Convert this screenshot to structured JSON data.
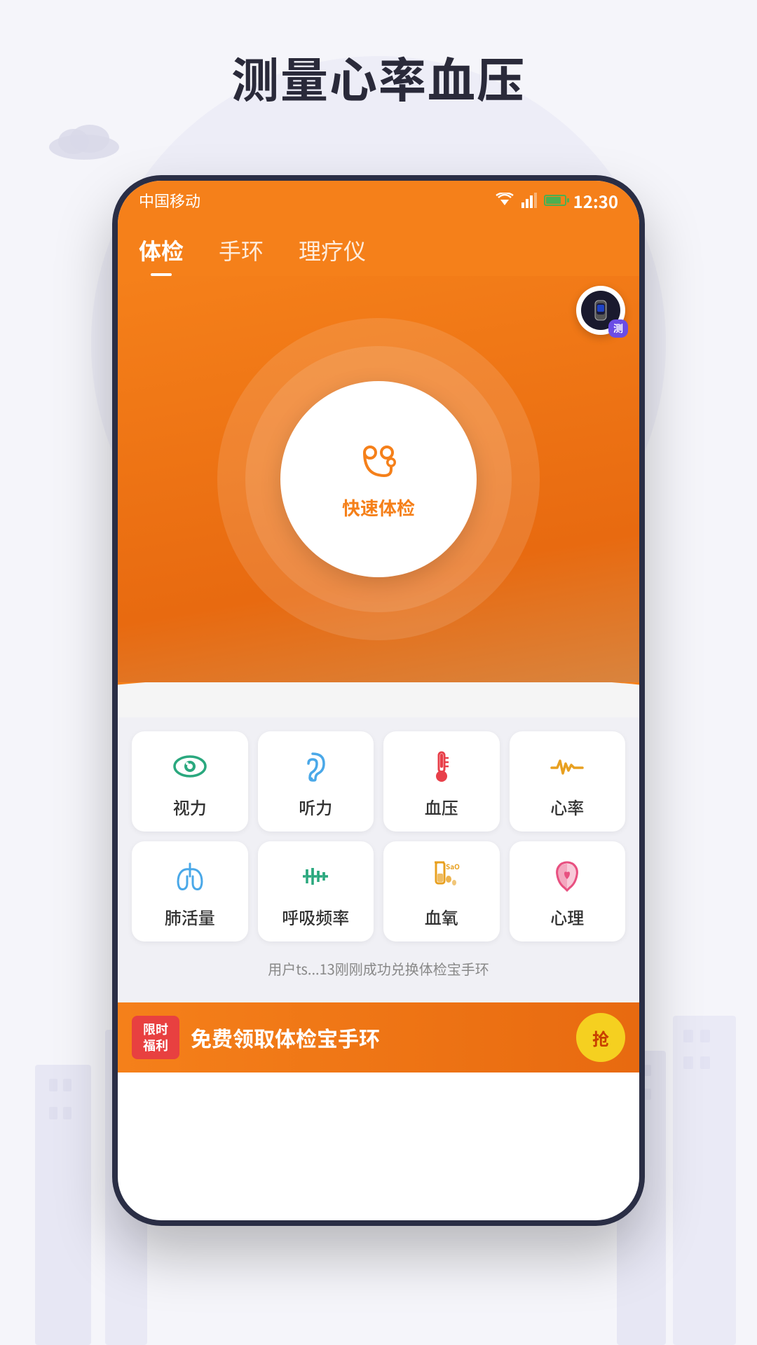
{
  "page": {
    "title": "测量心率血压",
    "background_color": "#f0f0f8"
  },
  "status_bar": {
    "carrier": "中国移动",
    "time": "12:30",
    "battery_color": "#4caf50"
  },
  "nav_tabs": [
    {
      "id": "ti_jian",
      "label": "体检",
      "active": true
    },
    {
      "id": "shou_huan",
      "label": "手环",
      "active": false
    },
    {
      "id": "li_liao_yi",
      "label": "理疗仪",
      "active": false
    }
  ],
  "hero": {
    "center_label": "快速体检",
    "stethoscope_unicode": "🩺"
  },
  "device_badge": {
    "label": "测"
  },
  "features_row1": [
    {
      "id": "vision",
      "label": "视力",
      "icon_type": "eye"
    },
    {
      "id": "hearing",
      "label": "听力",
      "icon_type": "ear"
    },
    {
      "id": "blood_pressure",
      "label": "血压",
      "icon_type": "thermometer"
    },
    {
      "id": "heart_rate",
      "label": "心率",
      "icon_type": "ecg"
    }
  ],
  "features_row2": [
    {
      "id": "lung_capacity",
      "label": "肺活量",
      "icon_type": "lung"
    },
    {
      "id": "breathing_rate",
      "label": "呼吸频率",
      "icon_type": "wave"
    },
    {
      "id": "blood_oxygen",
      "label": "血氧",
      "icon_type": "tube"
    },
    {
      "id": "mental",
      "label": "心理",
      "icon_type": "brain"
    }
  ],
  "notification": {
    "text": "用户ts...13刚刚成功兑换体检宝手环"
  },
  "promo_banner": {
    "badge_line1": "限时",
    "badge_line2": "福利",
    "text": "免费领取体检宝手环",
    "btn_label": "抢"
  }
}
